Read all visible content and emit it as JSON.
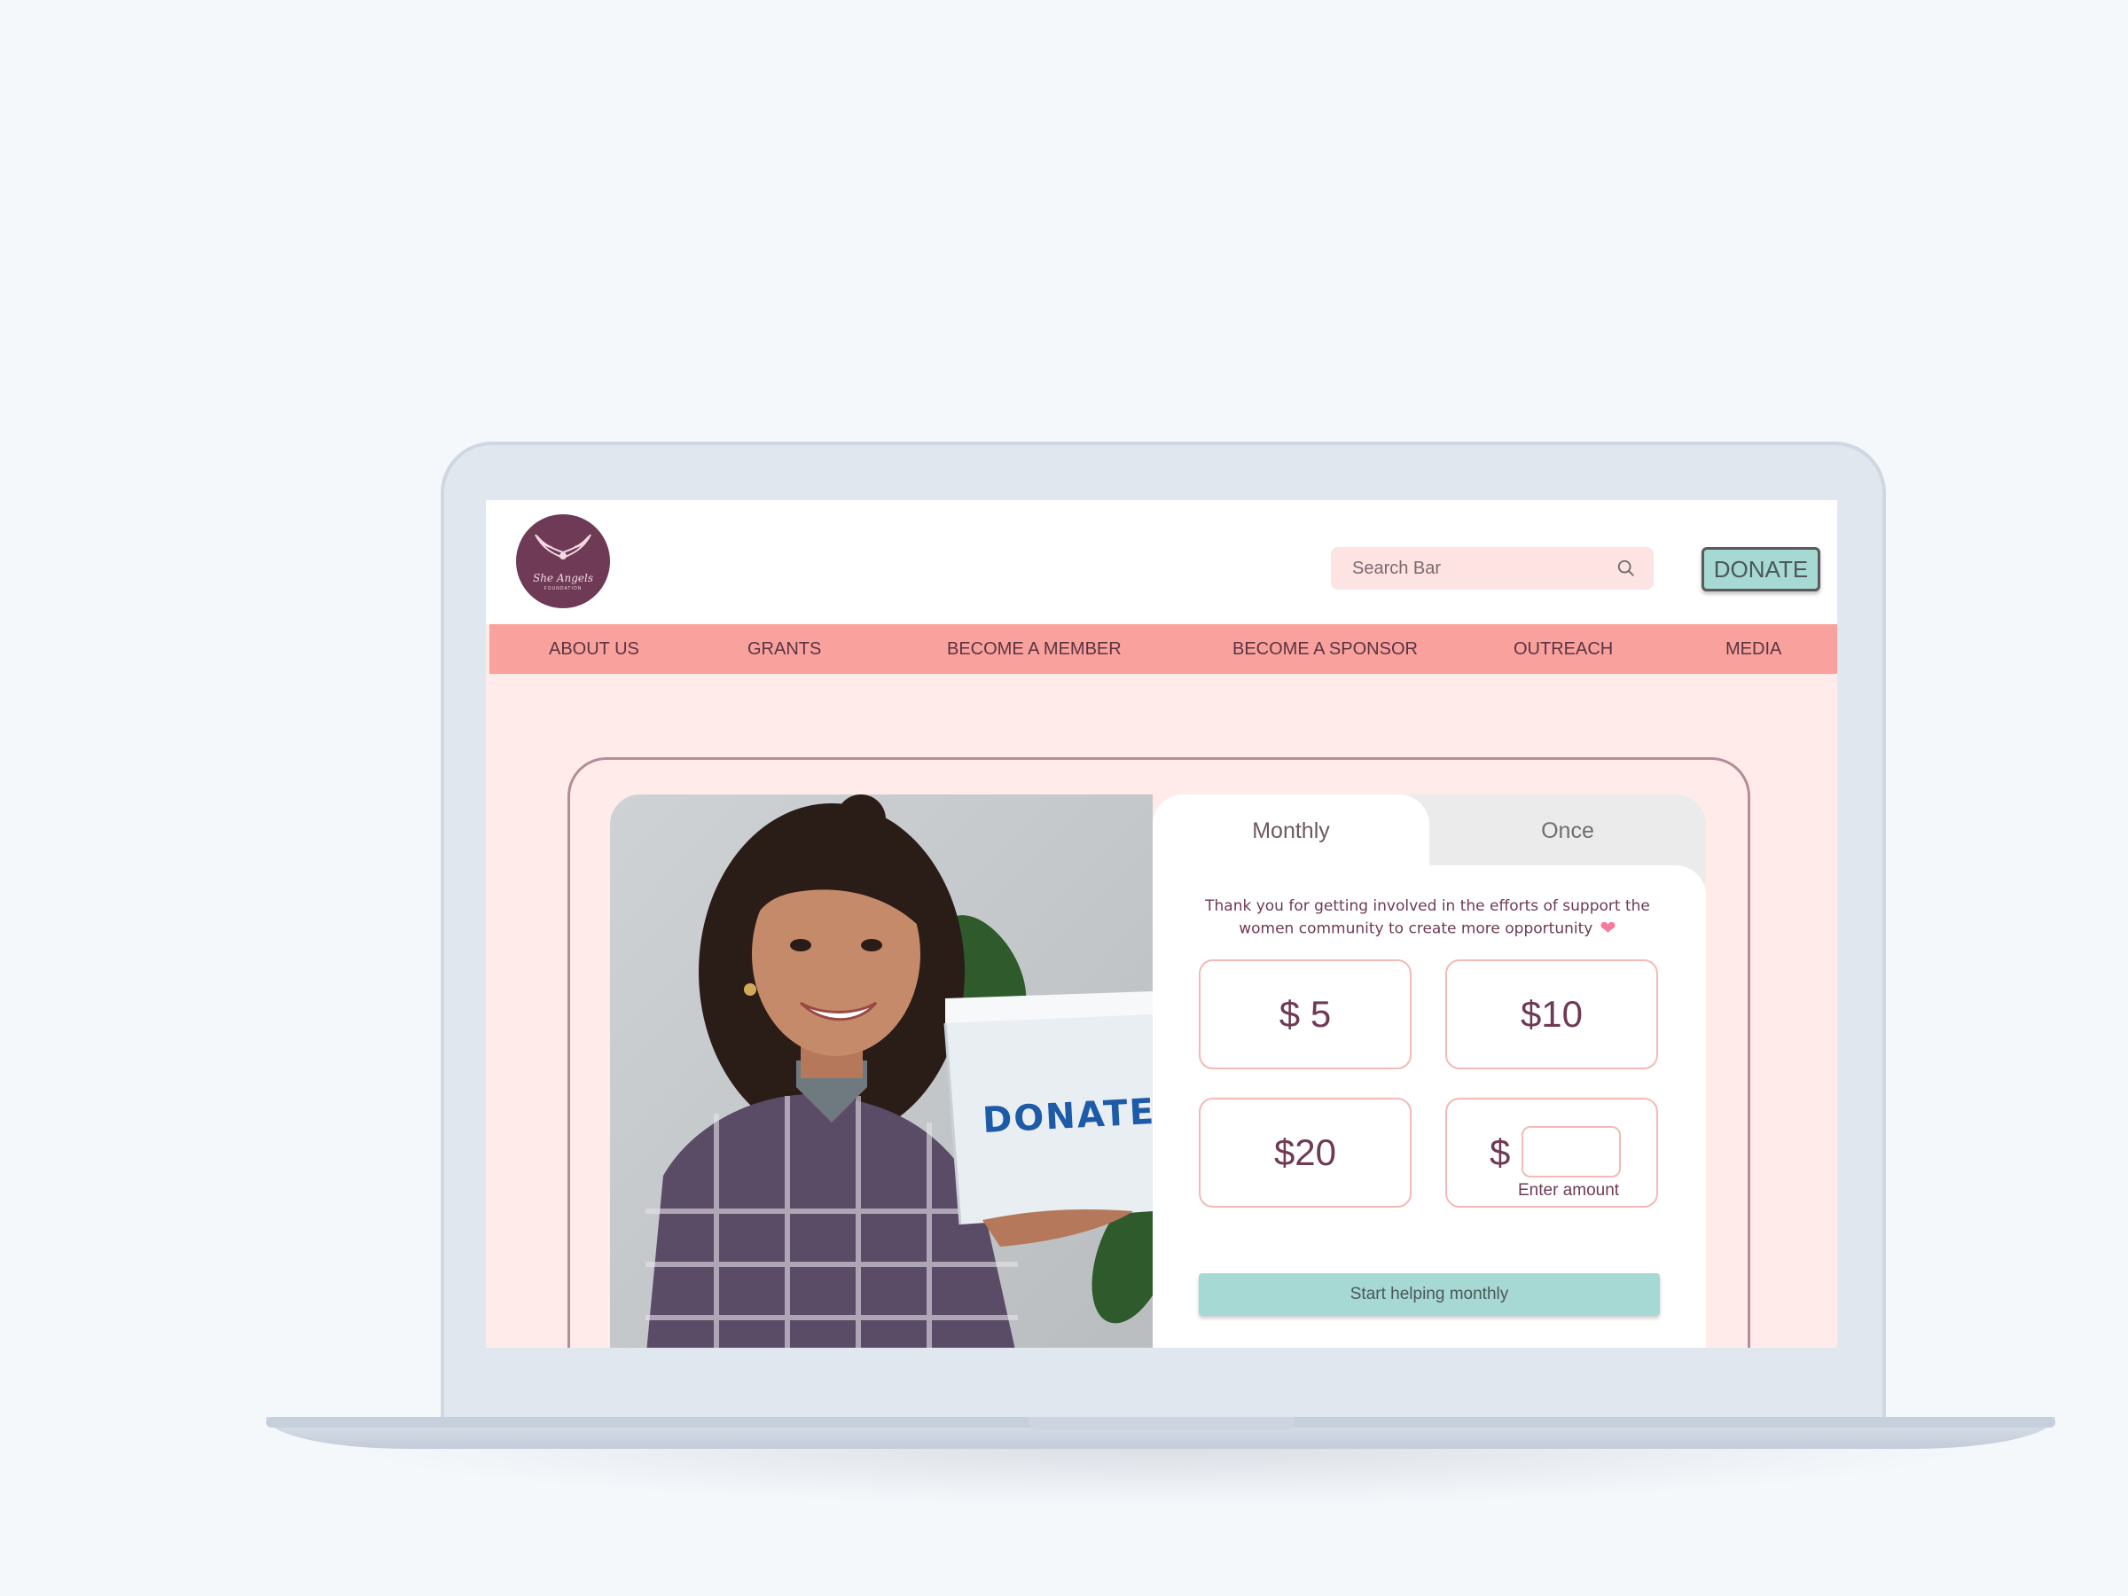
{
  "header": {
    "logo_text": "She Angels",
    "logo_sub": "FOUNDATION",
    "search_placeholder": "Search Bar",
    "donate_label": "DONATE"
  },
  "nav": {
    "items": [
      "ABOUT US",
      "GRANTS",
      "BECOME A MEMBER",
      "BECOME A SPONSOR",
      "OUTREACH",
      "MEDIA"
    ]
  },
  "donation": {
    "photo_box_label": "DONATE",
    "tabs": [
      "Monthly",
      "Once"
    ],
    "selected_tab": "Monthly",
    "thanks_line1": "Thank you for getting involved in the efforts of support the",
    "thanks_line2": "women community to create more opportunity",
    "amounts": [
      "$ 5",
      "$10",
      "$20"
    ],
    "custom_symbol": "$",
    "custom_hint": "Enter amount",
    "cta_label": "Start helping monthly"
  },
  "colors": {
    "nav_bg": "#f9a19c",
    "page_bg": "#ffecea",
    "accent_teal": "#a6d8d4",
    "brand_plum": "#6e3a55",
    "amount_border": "#f5b9b6"
  }
}
